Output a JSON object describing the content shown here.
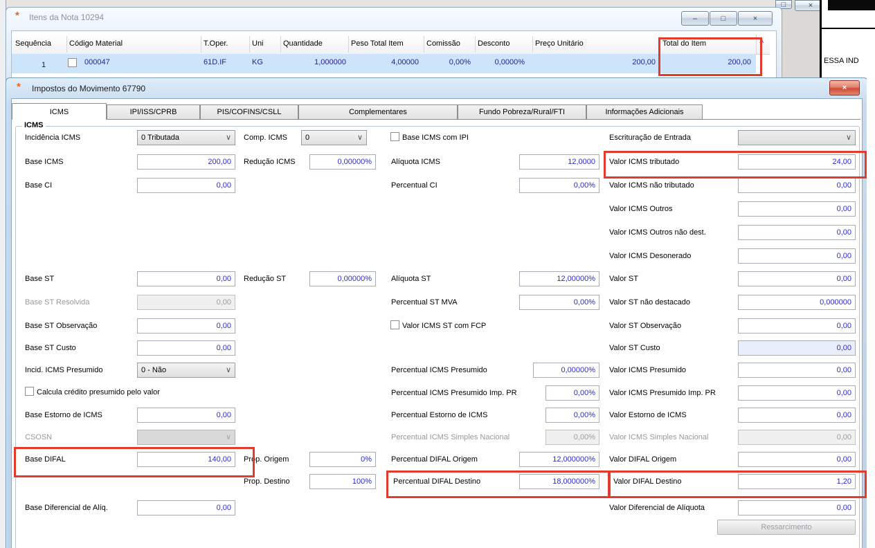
{
  "icons": {
    "app": "*",
    "minimize": "–",
    "maximize": "□",
    "close": "×",
    "chevron": "∨",
    "scroll_up": "^"
  },
  "bg": {
    "essa": "ESSA IND"
  },
  "w1": {
    "title": "Itens da Nota 10294",
    "columns": [
      "Sequência",
      "Código Material",
      "T.Oper.",
      "Uni",
      "Quantidade",
      "Peso Total Item",
      "Comissão",
      "Desconto",
      "Preço Unitário",
      "Total do Item"
    ],
    "row": {
      "seq": "1",
      "codigo": "000047",
      "toper": "61D.IF",
      "uni": "KG",
      "quantidade": "1,000000",
      "peso": "4,00000",
      "comissao": "0,00%",
      "desconto": "0,0000%",
      "preco": "200,00",
      "total": "200,00"
    }
  },
  "imp": {
    "title": "Impostos do Movimento 67790",
    "tabs": [
      "ICMS",
      "IPI/ISS/CPRB",
      "PIS/COFINS/CSLL",
      "Complementares",
      "Fundo Pobreza/Rural/FTI",
      "Informações Adicionais"
    ],
    "group": "ICMS",
    "ressarcimento": "Ressarcimento",
    "f": {
      "incidencia_icms": {
        "label": "Incidência ICMS",
        "value": "0 Tributada"
      },
      "comp_icms": {
        "label": "Comp. ICMS",
        "value": "0"
      },
      "chk_base_icms_ipi": {
        "label": "Base ICMS com IPI"
      },
      "escrituracao_entrada": {
        "label": "Escrituração de Entrada",
        "value": ""
      },
      "base_icms": {
        "label": "Base ICMS",
        "value": "200,00"
      },
      "reducao_icms": {
        "label": "Redução ICMS",
        "value": "0,00000%"
      },
      "aliquota_icms": {
        "label": "Alíquota ICMS",
        "value": "12,0000"
      },
      "valor_icms_tributado": {
        "label": "Valor ICMS tributado",
        "value": "24,00"
      },
      "base_ci": {
        "label": "Base CI",
        "value": "0,00"
      },
      "percentual_ci": {
        "label": "Percentual CI",
        "value": "0,00%"
      },
      "valor_icms_nao_tributado": {
        "label": "Valor ICMS não tributado",
        "value": "0,00"
      },
      "valor_icms_outros": {
        "label": "Valor ICMS Outros",
        "value": "0,00"
      },
      "valor_icms_outros_nao_dest": {
        "label": "Valor ICMS Outros não dest.",
        "value": "0,00"
      },
      "valor_icms_desonerado": {
        "label": "Valor ICMS Desonerado",
        "value": "0,00"
      },
      "base_st": {
        "label": "Base ST",
        "value": "0,00"
      },
      "reducao_st": {
        "label": "Redução ST",
        "value": "0,00000%"
      },
      "aliquota_st": {
        "label": "Alíquota ST",
        "value": "12,00000%"
      },
      "valor_st": {
        "label": "Valor ST",
        "value": "0,00"
      },
      "base_st_resolvida": {
        "label": "Base ST Resolvida",
        "value": "0,00"
      },
      "percentual_st_mva": {
        "label": "Percentual ST MVA",
        "value": "0,00%"
      },
      "valor_st_nao_destacado": {
        "label": "Valor ST não destacado",
        "value": "0,000000"
      },
      "base_st_observacao": {
        "label": "Base ST Observação",
        "value": "0,00"
      },
      "chk_valor_icms_st_fcp": {
        "label": "Valor ICMS ST com FCP"
      },
      "valor_st_observacao": {
        "label": "Valor ST Observação",
        "value": "0,00"
      },
      "base_st_custo": {
        "label": "Base ST Custo",
        "value": "0,00"
      },
      "valor_st_custo": {
        "label": "Valor ST Custo",
        "value": "0,00"
      },
      "incid_icms_presumido": {
        "label": "Incid. ICMS Presumido",
        "value": "0 - Não"
      },
      "percentual_icms_presumido": {
        "label": "Percentual ICMS Presumido",
        "value": "0,00000%"
      },
      "valor_icms_presumido": {
        "label": "Valor ICMS Presumido",
        "value": "0,00"
      },
      "chk_calcula_credito": {
        "label": "Calcula crédito presumido pelo valor"
      },
      "percentual_icms_presumido_pr": {
        "label": "Percentual ICMS Presumido Imp. PR",
        "value": "0,00%"
      },
      "valor_icms_presumido_pr": {
        "label": "Valor ICMS Presumido Imp. PR",
        "value": "0,00"
      },
      "base_estorno_icms": {
        "label": "Base Estorno de ICMS",
        "value": "0,00"
      },
      "percentual_estorno_icms": {
        "label": "Percentual Estorno de ICMS",
        "value": "0,00%"
      },
      "valor_estorno_icms": {
        "label": "Valor Estorno de ICMS",
        "value": "0,00"
      },
      "csosn": {
        "label": "CSOSN",
        "value": ""
      },
      "percentual_icms_simples": {
        "label": "Percentual ICMS Simples Nacional",
        "value": "0,00%"
      },
      "valor_icms_simples": {
        "label": "Valor ICMS Simples Nacional",
        "value": "0,00"
      },
      "base_difal": {
        "label": "Base DIFAL",
        "value": "140,00"
      },
      "prop_origem": {
        "label": "Prop. Origem",
        "value": "0%"
      },
      "percentual_difal_origem": {
        "label": "Percentual DIFAL Origem",
        "value": "12,000000%"
      },
      "valor_difal_origem": {
        "label": "Valor DIFAL Origem",
        "value": "0,00"
      },
      "prop_destino": {
        "label": "Prop. Destino",
        "value": "100%"
      },
      "percentual_difal_destino": {
        "label": "Percentual DIFAL Destino",
        "value": "18,000000%"
      },
      "valor_difal_destino": {
        "label": "Valor DIFAL Destino",
        "value": "1,20"
      },
      "base_diferencial_aliq": {
        "label": "Base Diferencial de Alíq.",
        "value": "0,00"
      },
      "valor_diferencial_aliquota": {
        "label": "Valor Diferencial de Alíquota",
        "value": "0,00"
      }
    }
  }
}
